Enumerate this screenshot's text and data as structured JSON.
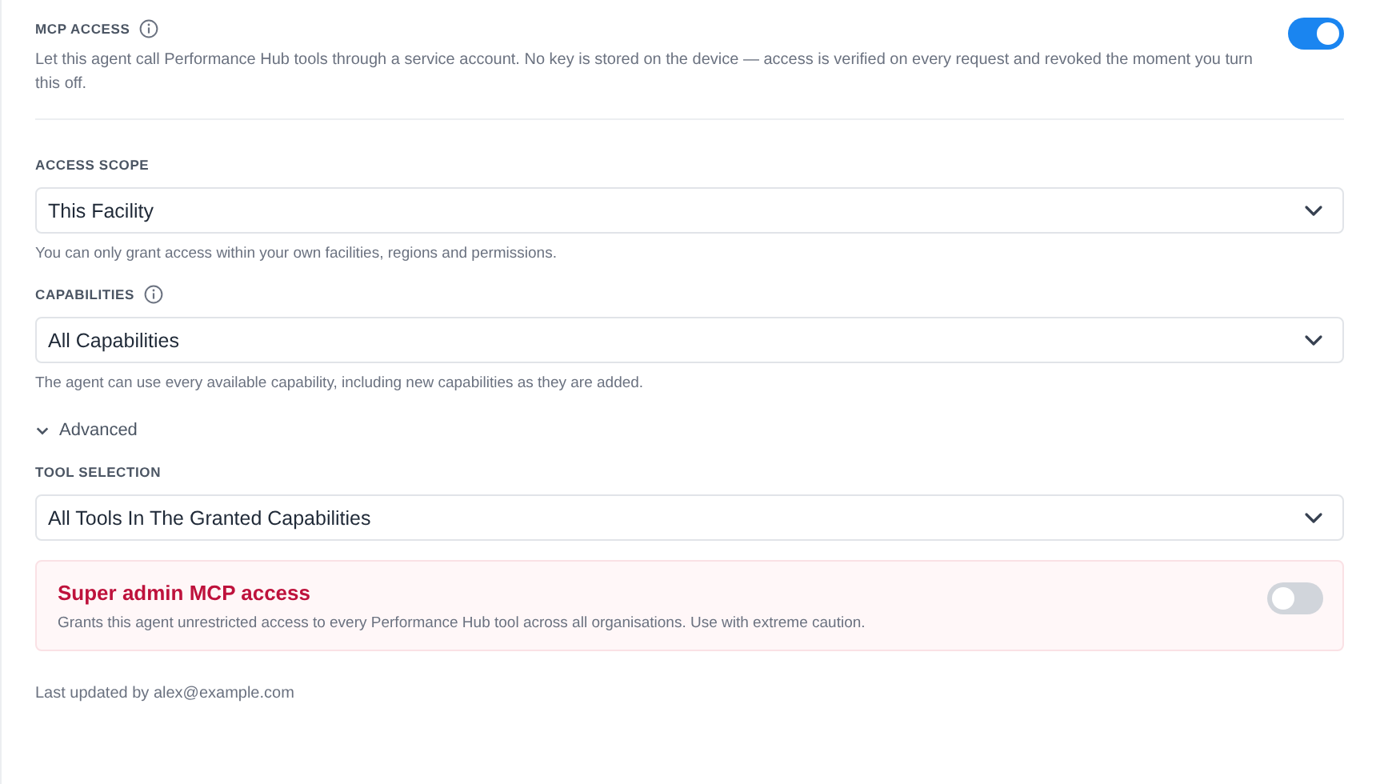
{
  "mcp_access": {
    "label": "MCP ACCESS",
    "on": true,
    "description": "Let this agent call Performance Hub tools through a service account. No key is stored on the device — access is verified on every request and revoked the moment you turn this off."
  },
  "fields": [
    {
      "label": "ACCESS SCOPE",
      "info": false,
      "value": "This Facility",
      "help": "You can only grant access within your own facilities, regions and permissions."
    },
    {
      "label": "CAPABILITIES",
      "info": true,
      "value": "All Capabilities",
      "help": "The agent can use every available capability, including new capabilities as they are added."
    }
  ],
  "advanced": {
    "label": "Advanced",
    "expanded": true,
    "fields": [
      {
        "label": "TOOL SELECTION",
        "info": false,
        "value": "All Tools In The Granted Capabilities"
      }
    ]
  },
  "super_admin": {
    "title": "Super admin MCP access",
    "on": false,
    "description": "Grants this agent unrestricted access to every Performance Hub tool across all organisations. Use with extreme caution."
  },
  "footer": "Last updated by alex@example.com"
}
